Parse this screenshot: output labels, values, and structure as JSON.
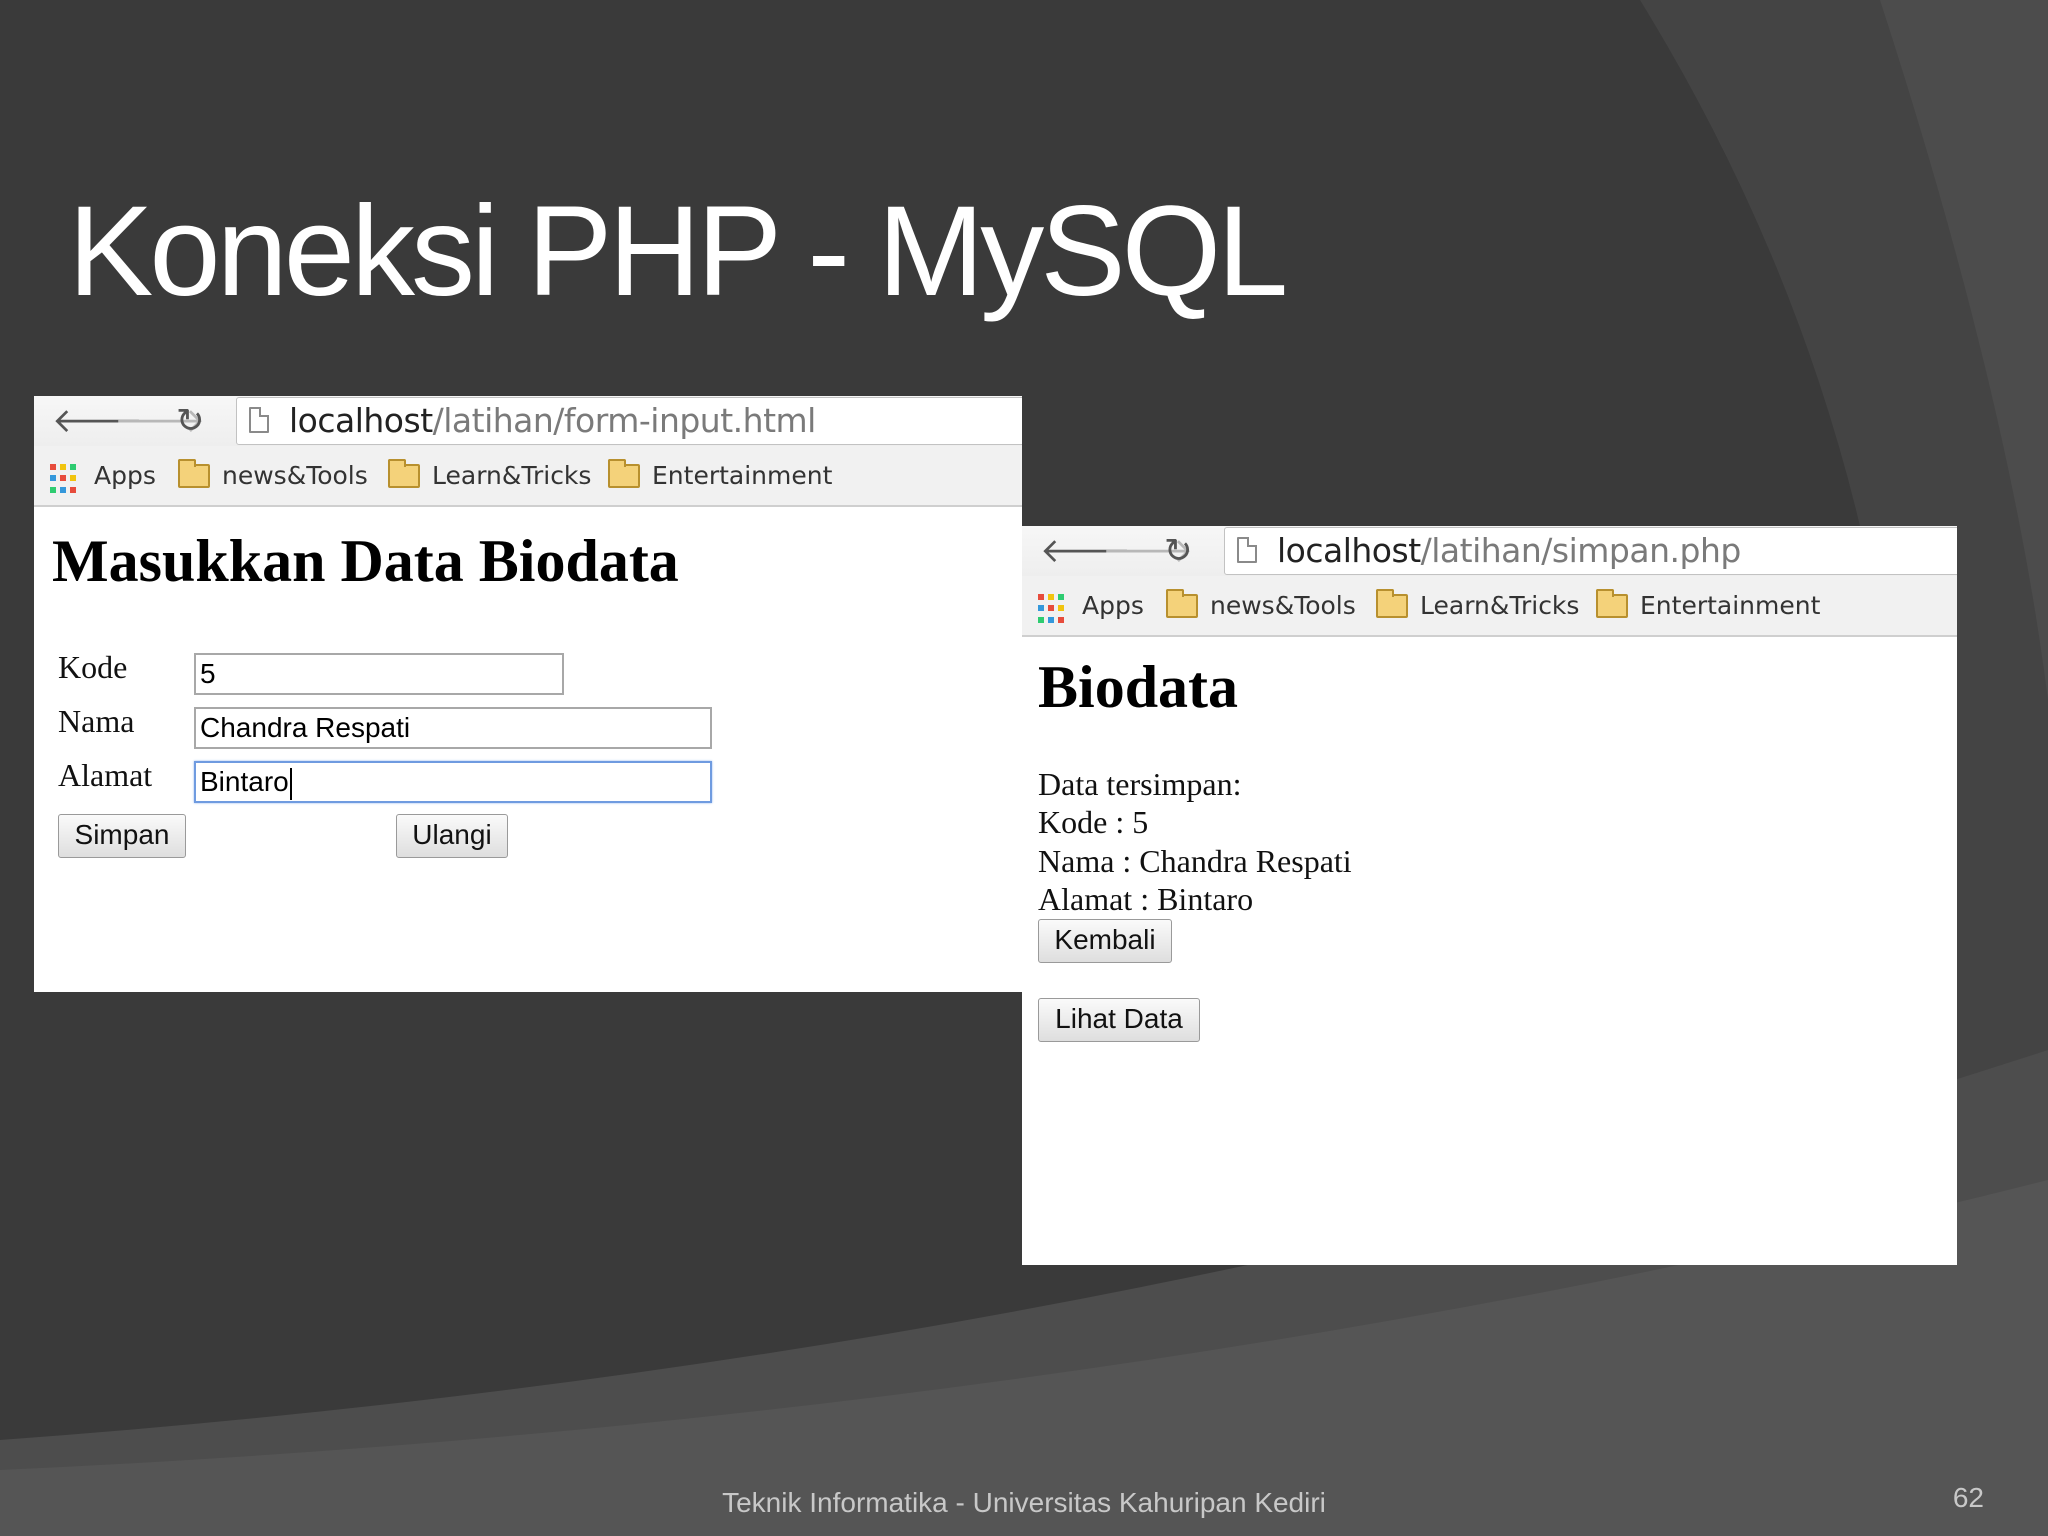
{
  "slide": {
    "title": "Koneksi PHP - MySQL",
    "footer": "Teknik Informatika - Universitas Kahuripan Kediri",
    "page_number": "62"
  },
  "bookmarks": [
    "Apps",
    "news&Tools",
    "Learn&Tricks",
    "Entertainment"
  ],
  "browser_form": {
    "url_host": "localhost",
    "url_path": "/latihan/form-input.html",
    "heading": "Masukkan Data Biodata",
    "fields": [
      {
        "label": "Kode",
        "value": "5"
      },
      {
        "label": "Nama",
        "value": "Chandra Respati"
      },
      {
        "label": "Alamat",
        "value": "Bintaro"
      }
    ],
    "submit_label": "Simpan",
    "reset_label": "Ulangi"
  },
  "browser_result": {
    "url_host": "localhost",
    "url_path": "/latihan/simpan.php",
    "heading": "Biodata",
    "lines": [
      "Data tersimpan:",
      "Kode : 5",
      "Nama : Chandra Respati",
      "Alamat : Bintaro"
    ],
    "back_label": "Kembali",
    "view_label": "Lihat Data"
  },
  "colors": {
    "slide_bg": "#3a3a3a",
    "title_text": "#ffffff",
    "focus_border": "#6f9be0"
  },
  "icons": {
    "back": "arrow-left-icon",
    "forward": "arrow-right-icon",
    "reload": "reload-icon",
    "page": "page-icon",
    "apps": "apps-grid-icon",
    "folder": "folder-icon"
  }
}
